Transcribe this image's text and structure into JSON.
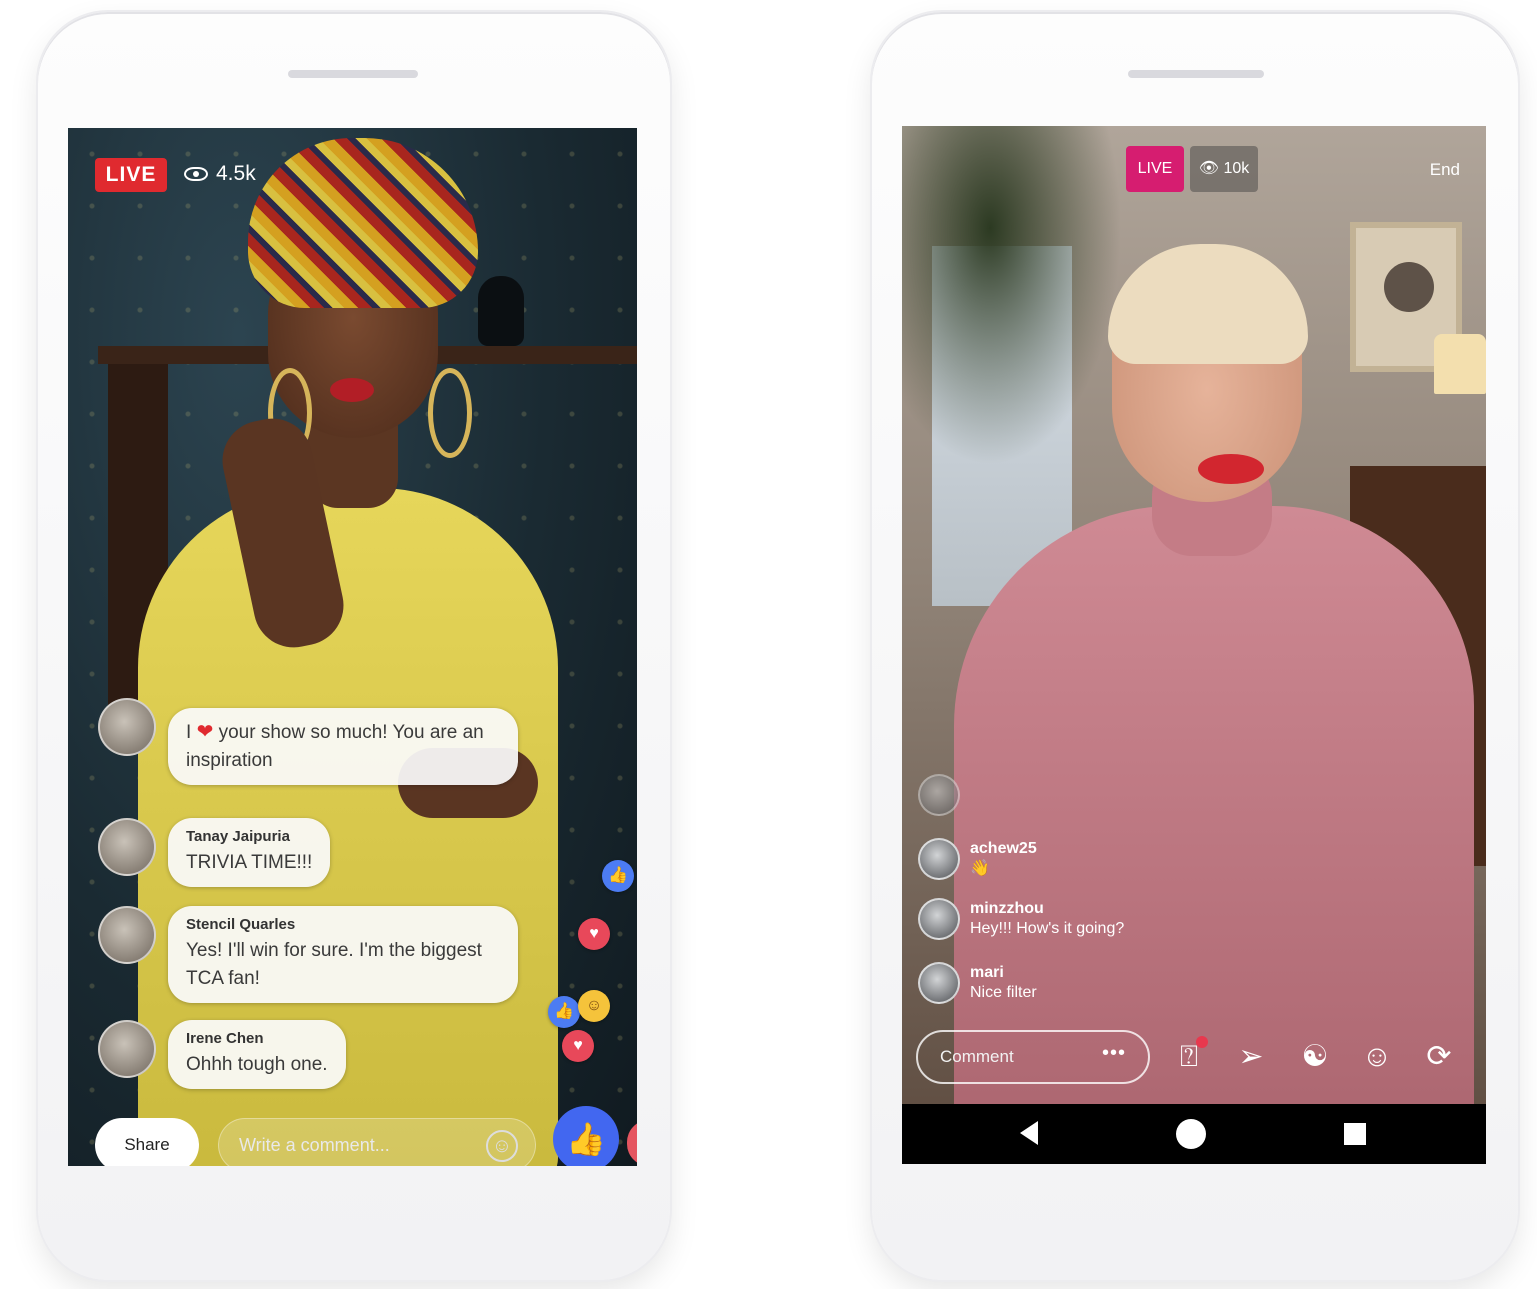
{
  "phone_facebook": {
    "live_badge": "LIVE",
    "viewer_count": "4.5k",
    "comments": [
      {
        "author": "",
        "text_before_icon": "I",
        "text_after_icon": "your show so much! You are an inspiration"
      },
      {
        "author": "Tanay Jaipuria",
        "text": "TRIVIA TIME!!!"
      },
      {
        "author": "Stencil Quarles",
        "text": "Yes! I'll win for sure. I'm the biggest TCA fan!"
      },
      {
        "author": "Irene Chen",
        "text": "Ohhh tough one."
      }
    ],
    "share_label": "Share",
    "comment_placeholder": "Write a comment...",
    "colors": {
      "live": "#e02a2f",
      "like": "#4267f0"
    },
    "icons": [
      "eye-icon",
      "heart-icon",
      "smiley-icon",
      "thumbs-up-icon",
      "love-reaction-icon",
      "haha-reaction-icon"
    ]
  },
  "phone_instagram": {
    "live_badge": "LIVE",
    "viewer_count": "10k",
    "end_label": "End",
    "comments": [
      {
        "author": "",
        "text": "",
        "faded": true
      },
      {
        "author": "achew25",
        "text": "👋"
      },
      {
        "author": "minzzhou",
        "text": "Hey!!! How's it going?"
      },
      {
        "author": "mari",
        "text": "Nice filter"
      }
    ],
    "comment_placeholder": "Comment",
    "more_label": "•••",
    "colors": {
      "live": "#d61d70"
    },
    "icons": [
      "question-sticker-icon",
      "send-icon",
      "face-filter-icon",
      "face-effect-icon",
      "flip-camera-icon",
      "back-nav-icon",
      "home-nav-icon",
      "recents-nav-icon"
    ]
  }
}
